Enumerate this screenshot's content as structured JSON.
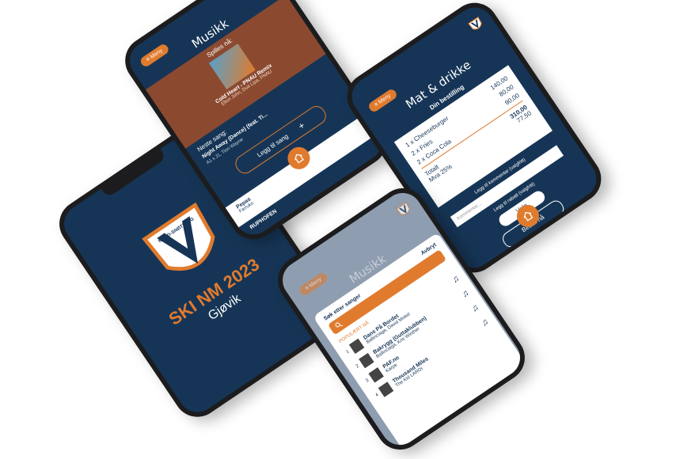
{
  "splash": {
    "badge_text": "NORD-SNØTTLAG",
    "title": "SKI NM 2023",
    "subtitle": "Gjøvik"
  },
  "music_top": {
    "menu_label": "Meny",
    "title": "Musikk",
    "now_playing_label": "Spilles nå:",
    "track_title": "Cold Heart - PNAU Remix",
    "track_artist": "Elton John, Dua Lipa, PNAU",
    "next_label": "Neste sang:",
    "next_track": "Night Away (Dance) (feat. Ti...",
    "next_artist": "A1 x J1, Tion Wayne",
    "add_song_label": "Legg til sang",
    "list_item_title": "Pepas",
    "list_item_artist": "Farruko",
    "footer_label": "RUPHOFEN"
  },
  "food": {
    "menu_label": "Meny",
    "title": "Mat & drikke",
    "order_label": "Din bestilling",
    "items": [
      {
        "qty": "1 x",
        "name": "Cheeseburger",
        "price": "140,00"
      },
      {
        "qty": "2 x",
        "name": "Fries",
        "price": "80,00"
      },
      {
        "qty": "2 x",
        "name": "Coca Cola",
        "price": "90,00"
      }
    ],
    "total_label": "Totalt",
    "vat_label": "Mva 25%",
    "total_value": "310,00",
    "vat_value": "77,50",
    "comment_label": "Legg til kommentar (valgfritt)",
    "comment_placeholder": "Kommentar...",
    "discount_label": "Legg til rabatt (valgfritt)",
    "choose_label": "Velg",
    "order_button": "Bestill nå"
  },
  "music_search": {
    "menu_label": "Meny",
    "title": "Musikk",
    "search_label": "Søk etter sanger",
    "cancel_label": "Avbryt",
    "popular_label": "POPULÆRT NÅ",
    "songs": [
      {
        "rank": "1",
        "title": "Dans På Bordet",
        "artist": "Ballinciaga, David Mokel"
      },
      {
        "rank": "2",
        "title": "Bakrygg (Guttaklubben)",
        "artist": "Ballinciaga, Kris Winther"
      },
      {
        "rank": "3",
        "title": "PAF.no",
        "artist": "Karpe"
      },
      {
        "rank": "4",
        "title": "Thousand Miles",
        "artist": "The Kid LAROI"
      }
    ]
  }
}
